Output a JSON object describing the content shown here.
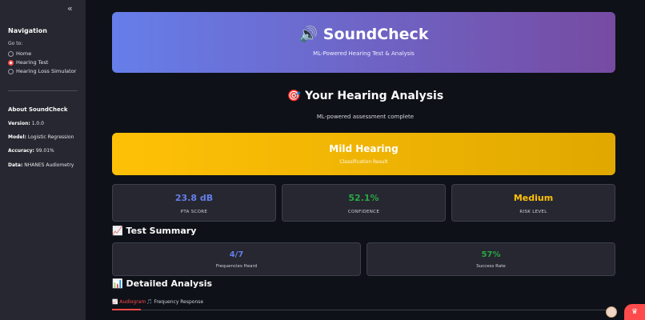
{
  "sidebar": {
    "collapse_icon": "«",
    "title": "Navigation",
    "goto_label": "Go to:",
    "options": [
      {
        "label": "Home",
        "selected": false
      },
      {
        "label": "Hearing Test",
        "selected": true
      },
      {
        "label": "Hearing Loss Simulator",
        "selected": false
      }
    ],
    "about_title": "About SoundCheck",
    "meta": [
      {
        "key": "Version:",
        "value": "1.0.0"
      },
      {
        "key": "Model:",
        "value": "Logistic Regression"
      },
      {
        "key": "Accuracy:",
        "value": "99.01%"
      },
      {
        "key": "Data:",
        "value": "NHANES Audiometry"
      }
    ]
  },
  "hero": {
    "title": "🔊 SoundCheck",
    "subtitle": "ML-Powered Hearing Test & Analysis"
  },
  "analysis": {
    "title": "🎯 Your Hearing Analysis",
    "subtitle": "ML-powered assessment complete"
  },
  "result": {
    "title": "Mild Hearing",
    "subtitle": "Classification Result",
    "color": "#ffc107"
  },
  "metrics": [
    {
      "value": "23.8 dB",
      "label": "PTA SCORE",
      "color": "#667eea"
    },
    {
      "value": "52.1%",
      "label": "CONFIDENCE",
      "color": "#28a745"
    },
    {
      "value": "Medium",
      "label": "RISK LEVEL",
      "color": "#ffc107"
    }
  ],
  "summary": {
    "title": "📈 Test Summary",
    "cards": [
      {
        "value": "4/7",
        "label": "Frequencies Heard",
        "color": "#667eea"
      },
      {
        "value": "57%",
        "label": "Success Rate",
        "color": "#28a745"
      }
    ]
  },
  "detailed": {
    "title": "📊 Detailed Analysis",
    "tabs": [
      {
        "label": "📈 Audiogram",
        "active": true
      },
      {
        "label": "🎵 Frequency Response",
        "active": false
      }
    ]
  },
  "accent": "#ff4b4b"
}
